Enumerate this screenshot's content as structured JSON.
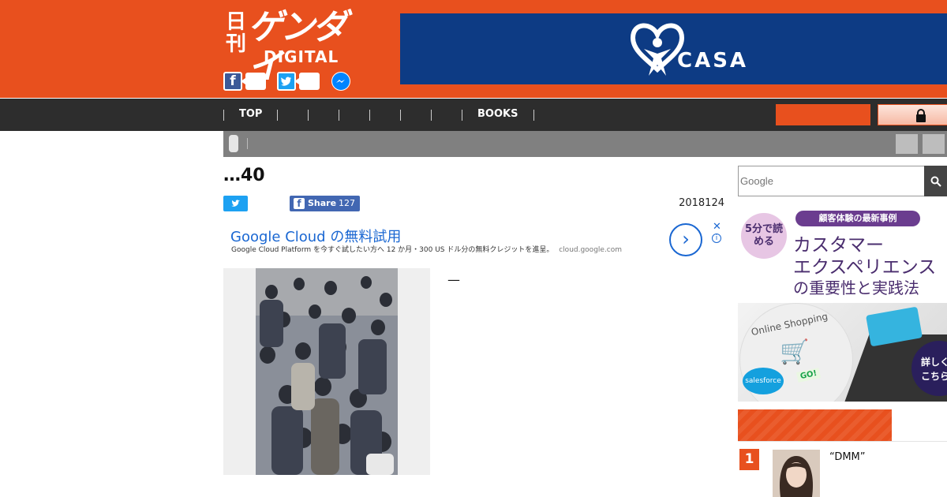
{
  "header": {
    "logo": {
      "kanji": "日刊",
      "main": "ゲンダイ",
      "sub": "DIGITAL"
    },
    "social": [
      "facebook-icon",
      "twitter-icon",
      "messenger-icon"
    ],
    "ad": {
      "brand": "CASA"
    }
  },
  "nav": {
    "items": [
      "TOP",
      "",
      "",
      "",
      "",
      "",
      "",
      "BOOKS"
    ]
  },
  "article": {
    "headline": "…40",
    "share_label": "Share",
    "share_count": "127",
    "date": "2018124",
    "dash": "—"
  },
  "google_ad": {
    "title": "Google Cloud の無料試用",
    "description": "Google Cloud Platform を今すぐ試したい方へ 12 か月・300 US ドル分の無料クレジットを進呈。",
    "url": "cloud.google.com",
    "close": "✕",
    "info": "i",
    "arrow": "›"
  },
  "sidebar": {
    "search_placeholder": "Google",
    "ad": {
      "circle": "5分で読める",
      "tag": "顧客体験の最新事例",
      "line1": "カスタマー",
      "line2": "エクスペリエンス",
      "line3": "の重要性と実践法",
      "shop": "Online Shopping",
      "go": "GO!",
      "logo": "salesforce",
      "cta": "詳しくはこちら"
    },
    "ranking": {
      "items": [
        {
          "rank": "1",
          "text": "“DMM”"
        }
      ]
    }
  },
  "colors": {
    "brand_orange": "#e8501e",
    "nav_dark": "#2d2d2d",
    "ad_blue": "#0d3b84",
    "google_blue": "#1a67d2"
  }
}
